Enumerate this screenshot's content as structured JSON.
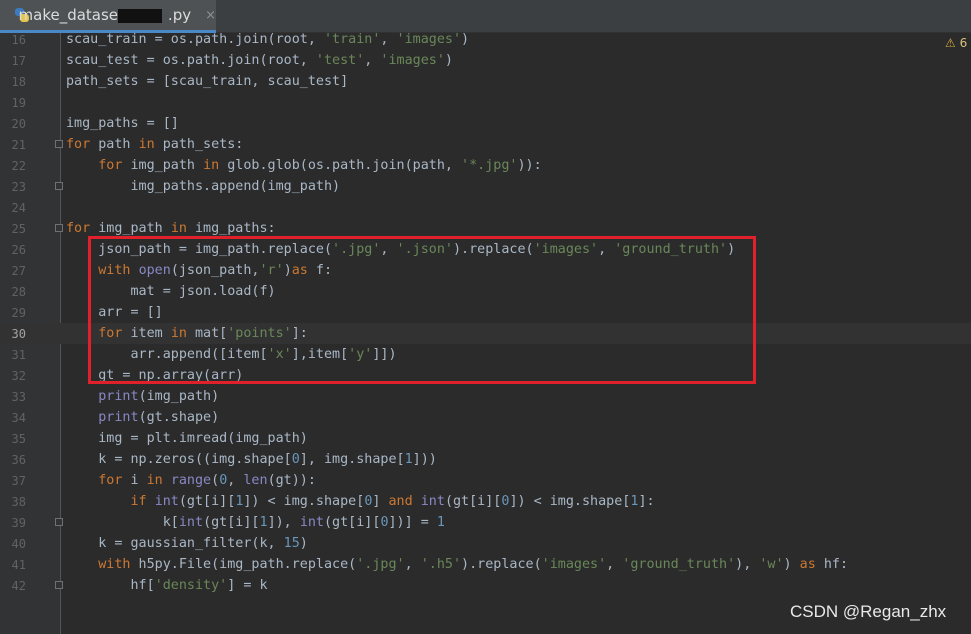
{
  "tab": {
    "filename": "make_dataset",
    "filename_suffix": ".py",
    "close_glyph": "×"
  },
  "inspection": {
    "glyph": "⚠",
    "count": "6"
  },
  "code_lines": [
    {
      "n": "16",
      "tokens": [
        [
          "",
          "scau_train = os.path.join(root, "
        ],
        [
          "str",
          "'train'"
        ],
        [
          "",
          ", "
        ],
        [
          "str",
          "'images'"
        ],
        [
          "",
          ")"
        ]
      ]
    },
    {
      "n": "17",
      "tokens": [
        [
          "",
          "scau_test = os.path.join(root, "
        ],
        [
          "str",
          "'test'"
        ],
        [
          "",
          ", "
        ],
        [
          "str",
          "'images'"
        ],
        [
          "",
          ")"
        ]
      ]
    },
    {
      "n": "18",
      "tokens": [
        [
          "",
          "path_sets = [scau_train, scau_test]"
        ]
      ]
    },
    {
      "n": "19",
      "tokens": []
    },
    {
      "n": "20",
      "tokens": [
        [
          "",
          "img_paths = []"
        ]
      ]
    },
    {
      "n": "21",
      "tokens": [
        [
          "kw",
          "for"
        ],
        [
          "",
          " path "
        ],
        [
          "kw",
          "in"
        ],
        [
          "",
          " path_sets:"
        ]
      ]
    },
    {
      "n": "22",
      "tokens": [
        [
          "",
          "    "
        ],
        [
          "kw",
          "for"
        ],
        [
          "",
          " img_path "
        ],
        [
          "kw",
          "in"
        ],
        [
          "",
          " glob.glob(os.path.join(path, "
        ],
        [
          "str",
          "'*.jpg'"
        ],
        [
          "",
          "))"
        ],
        [
          "",
          ":"
        ]
      ]
    },
    {
      "n": "23",
      "tokens": [
        [
          "",
          "        img_paths.append(img_path)"
        ]
      ]
    },
    {
      "n": "24",
      "tokens": []
    },
    {
      "n": "25",
      "tokens": [
        [
          "kw",
          "for"
        ],
        [
          "",
          " img_path "
        ],
        [
          "kw",
          "in"
        ],
        [
          "",
          " img_paths:"
        ]
      ]
    },
    {
      "n": "26",
      "tokens": [
        [
          "",
          "    json_path = img_path.replace("
        ],
        [
          "str",
          "'.jpg'"
        ],
        [
          "",
          ", "
        ],
        [
          "str",
          "'.json'"
        ],
        [
          "",
          ").replace("
        ],
        [
          "str",
          "'images'"
        ],
        [
          "",
          ", "
        ],
        [
          "str",
          "'ground_truth'"
        ],
        [
          "",
          ")"
        ]
      ]
    },
    {
      "n": "27",
      "tokens": [
        [
          "",
          "    "
        ],
        [
          "kw",
          "with"
        ],
        [
          "",
          " "
        ],
        [
          "bi",
          "open"
        ],
        [
          "",
          "(json_path,"
        ],
        [
          "str",
          "'r'"
        ],
        [
          "",
          ")"
        ],
        [
          "kw",
          "as"
        ],
        [
          "",
          " f:"
        ]
      ]
    },
    {
      "n": "28",
      "tokens": [
        [
          "",
          "        mat = json.load(f)"
        ]
      ]
    },
    {
      "n": "29",
      "tokens": [
        [
          "",
          "    arr = []"
        ]
      ]
    },
    {
      "n": "30",
      "tokens": [
        [
          "",
          "    "
        ],
        [
          "kw",
          "for"
        ],
        [
          "",
          " item "
        ],
        [
          "kw",
          "in"
        ],
        [
          "",
          " mat["
        ],
        [
          "str",
          "'points'"
        ],
        [
          "",
          "]:"
        ]
      ]
    },
    {
      "n": "31",
      "tokens": [
        [
          "",
          "        arr.append([item["
        ],
        [
          "str",
          "'x'"
        ],
        [
          "",
          "],item["
        ],
        [
          "str",
          "'y'"
        ],
        [
          "",
          "]])"
        ]
      ]
    },
    {
      "n": "32",
      "tokens": [
        [
          "",
          "    gt = np.array(arr)"
        ]
      ]
    },
    {
      "n": "33",
      "tokens": [
        [
          "",
          "    "
        ],
        [
          "bi",
          "print"
        ],
        [
          "",
          "(img_path)"
        ]
      ]
    },
    {
      "n": "34",
      "tokens": [
        [
          "",
          "    "
        ],
        [
          "bi",
          "print"
        ],
        [
          "",
          "(gt.shape)"
        ]
      ]
    },
    {
      "n": "35",
      "tokens": [
        [
          "",
          "    img = plt.imread(img_path)"
        ]
      ]
    },
    {
      "n": "36",
      "tokens": [
        [
          "",
          "    k = np.zeros((img.shape["
        ],
        [
          "num-lit",
          "0"
        ],
        [
          "",
          "], img.shape["
        ],
        [
          "num-lit",
          "1"
        ],
        [
          "",
          "]))"
        ]
      ]
    },
    {
      "n": "37",
      "tokens": [
        [
          "",
          "    "
        ],
        [
          "kw",
          "for"
        ],
        [
          "",
          " i "
        ],
        [
          "kw",
          "in"
        ],
        [
          "",
          " "
        ],
        [
          "bi",
          "range"
        ],
        [
          "",
          "("
        ],
        [
          "num-lit",
          "0"
        ],
        [
          "",
          ", "
        ],
        [
          "bi",
          "len"
        ],
        [
          "",
          "(gt)):"
        ]
      ]
    },
    {
      "n": "38",
      "tokens": [
        [
          "",
          "        "
        ],
        [
          "kw",
          "if"
        ],
        [
          "",
          " "
        ],
        [
          "bi",
          "int"
        ],
        [
          "",
          "(gt[i]["
        ],
        [
          "num-lit",
          "1"
        ],
        [
          "",
          "]) < img.shape["
        ],
        [
          "num-lit",
          "0"
        ],
        [
          "",
          "] "
        ],
        [
          "kw",
          "and"
        ],
        [
          "",
          " "
        ],
        [
          "bi",
          "int"
        ],
        [
          "",
          "(gt[i]["
        ],
        [
          "num-lit",
          "0"
        ],
        [
          "",
          "]) < img.shape["
        ],
        [
          "num-lit",
          "1"
        ],
        [
          "",
          "]:"
        ]
      ]
    },
    {
      "n": "39",
      "tokens": [
        [
          "",
          "            k["
        ],
        [
          "bi",
          "int"
        ],
        [
          "",
          "(gt[i]["
        ],
        [
          "num-lit",
          "1"
        ],
        [
          "",
          "]), "
        ],
        [
          "bi",
          "int"
        ],
        [
          "",
          "(gt[i]["
        ],
        [
          "num-lit",
          "0"
        ],
        [
          "",
          "])] = "
        ],
        [
          "num-lit",
          "1"
        ]
      ]
    },
    {
      "n": "40",
      "tokens": [
        [
          "",
          "    k = gaussian_filter(k, "
        ],
        [
          "num-lit",
          "15"
        ],
        [
          "",
          ")"
        ]
      ]
    },
    {
      "n": "41",
      "tokens": [
        [
          "",
          "    "
        ],
        [
          "kw",
          "with"
        ],
        [
          "",
          " h5py.File(img_path.replace("
        ],
        [
          "str",
          "'.jpg'"
        ],
        [
          "",
          ", "
        ],
        [
          "str",
          "'.h5'"
        ],
        [
          "",
          ").replace("
        ],
        [
          "str",
          "'images'"
        ],
        [
          "",
          ", "
        ],
        [
          "str",
          "'ground_truth'"
        ],
        [
          "",
          "), "
        ],
        [
          "str",
          "'w'"
        ],
        [
          "",
          ") "
        ],
        [
          "kw",
          "as"
        ],
        [
          "",
          " hf:"
        ]
      ]
    },
    {
      "n": "42",
      "tokens": [
        [
          "",
          "        hf["
        ],
        [
          "str",
          "'density'"
        ],
        [
          "",
          "] = k"
        ]
      ]
    }
  ],
  "current_line": "30",
  "folded_lines": [
    "21",
    "23",
    "25",
    "39",
    "42"
  ],
  "watermark": "CSDN @Regan_zhx"
}
